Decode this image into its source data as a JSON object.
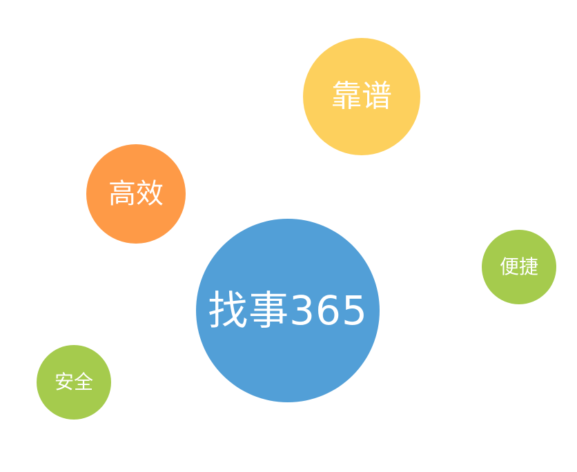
{
  "bubbles": {
    "center": {
      "label": "找事365",
      "color": "#529fd7"
    },
    "reliable": {
      "label": "靠谱",
      "color": "#fdd05d"
    },
    "efficient": {
      "label": "高效",
      "color": "#fe9a47"
    },
    "convenient": {
      "label": "便捷",
      "color": "#a5cb4d"
    },
    "safe": {
      "label": "安全",
      "color": "#a5cb4d"
    }
  }
}
